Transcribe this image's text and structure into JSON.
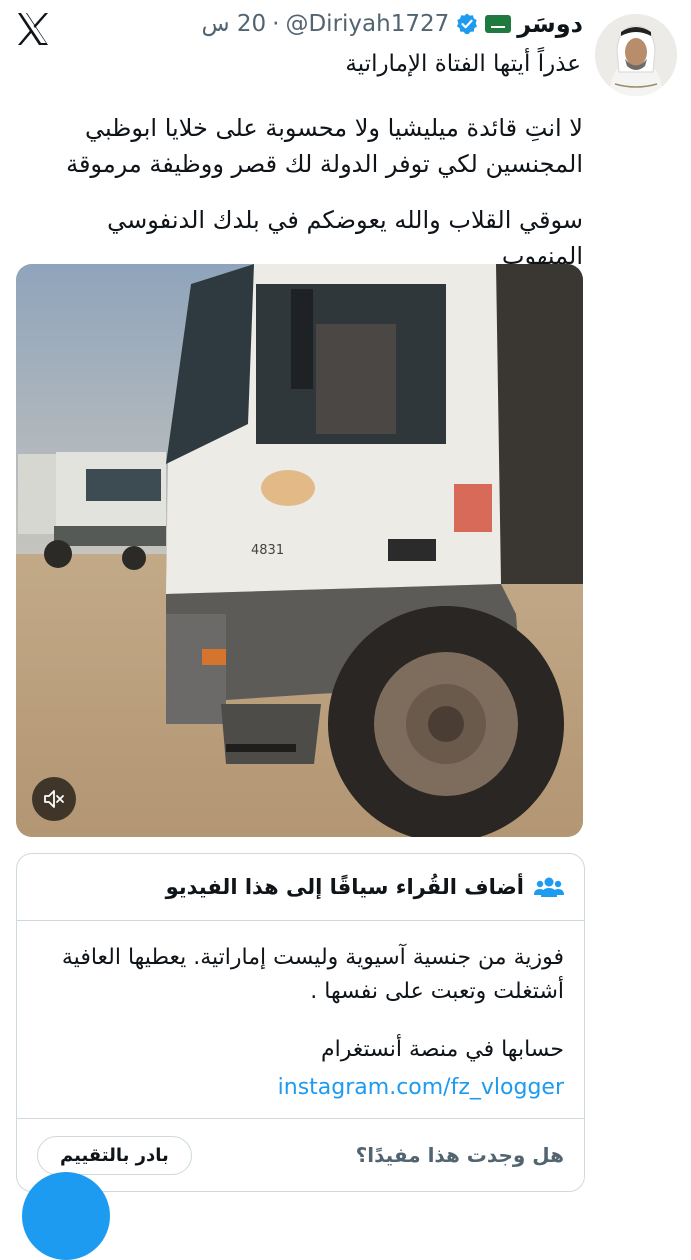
{
  "tweet": {
    "display_name": "دوسَر",
    "handle": "@Diriyah1727",
    "separator": "·",
    "time": "20 س",
    "headline": "عذراً أيتها الفتاة الإماراتية",
    "body_paragraphs": [
      "لا انتِ قائدة ميليشيا ولا محسوبة على خلايا ابوظبي المجنسين لكي توفر الدولة لك قصر ووظيفة مرموقة",
      "سوقي القلاب والله يعوضكم في بلدك الدنفوسي المنهوب"
    ]
  },
  "community_note": {
    "title": "أضاف القُراء سياقًا إلى هذا الفيديو",
    "paragraphs": [
      "فوزية من جنسية آسيوية وليست إماراتية. يعطيها العافية أشتغلت وتعبت على نفسها .",
      "حسابها في منصة أنستغرام"
    ],
    "link": "instagram.com/fz_vlogger",
    "question": "هل وجدت هذا مفيدًا؟",
    "rate_label": "بادر بالتقييم"
  },
  "icons": {
    "app_logo": "x-logo-icon",
    "verified": "verified-badge-icon",
    "flag": "saudi-flag-icon",
    "mute": "muted-speaker-icon",
    "note": "people-icon"
  },
  "colors": {
    "link": "#1d9bf0",
    "secondary_text": "#536471",
    "border": "#cfd9de"
  }
}
